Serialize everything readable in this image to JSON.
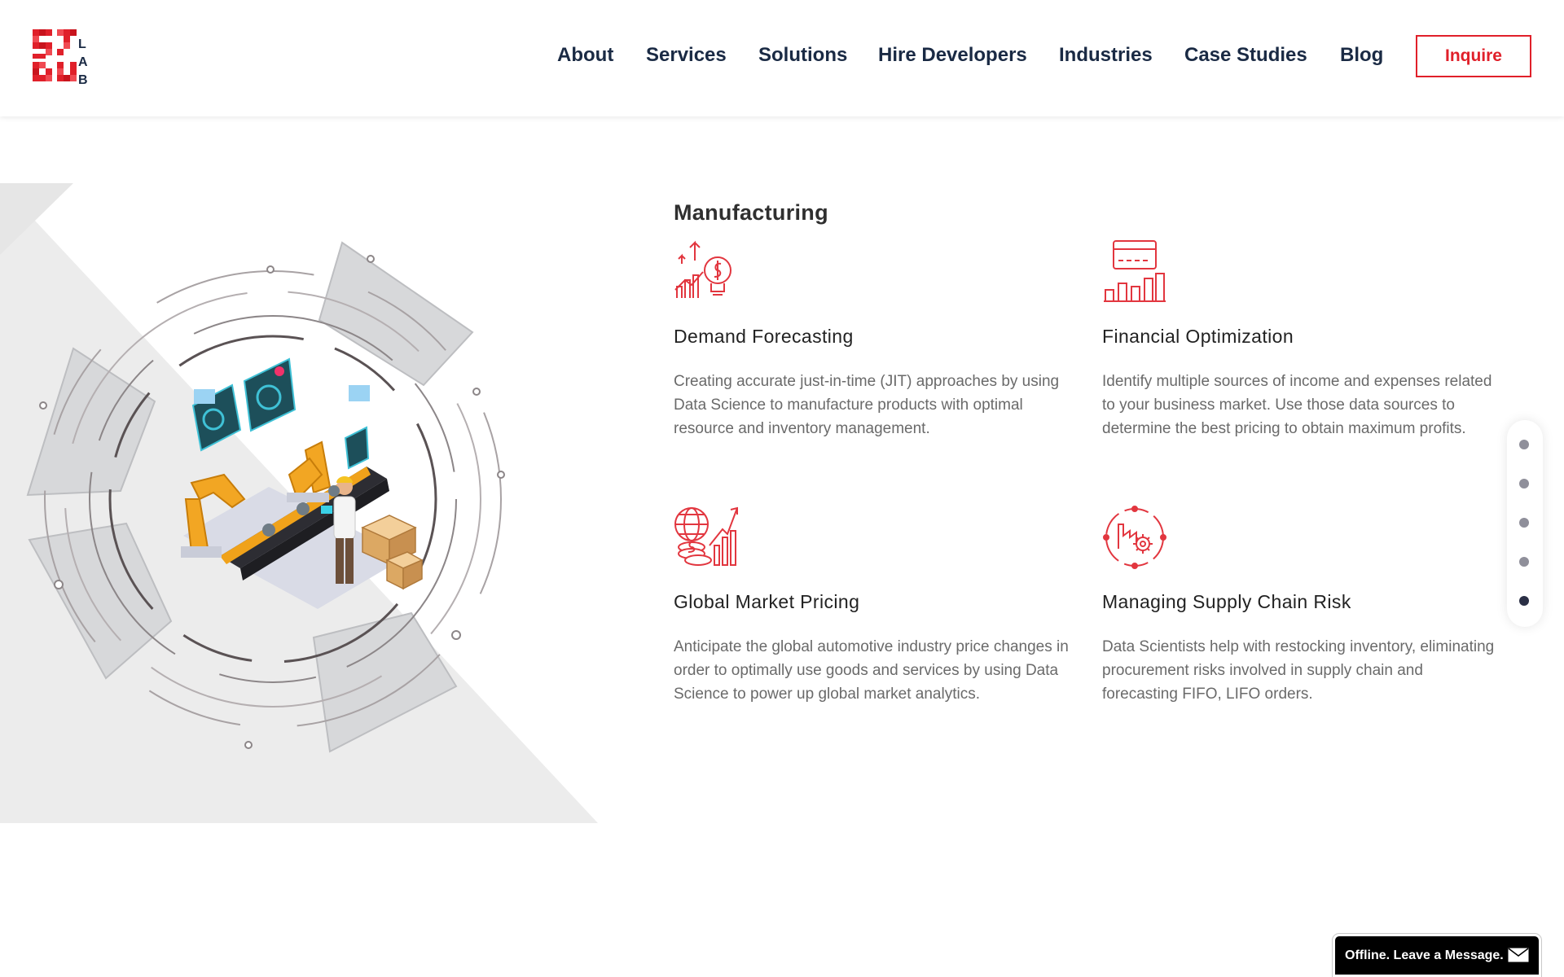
{
  "header": {
    "logo_letters": [
      "L",
      "A",
      "B"
    ],
    "nav": [
      {
        "label": "About"
      },
      {
        "label": "Services"
      },
      {
        "label": "Solutions"
      },
      {
        "label": "Hire Developers"
      },
      {
        "label": "Industries"
      },
      {
        "label": "Case Studies"
      },
      {
        "label": "Blog"
      }
    ],
    "cta_label": "Inquire"
  },
  "content": {
    "title": "Manufacturing",
    "features": [
      {
        "icon": "growth-lightbulb-icon",
        "title": "Demand Forecasting",
        "desc": "Creating accurate just-in-time (JIT) approaches by using Data Science to manufacture products with optimal resource and inventory management."
      },
      {
        "icon": "credit-card-chart-icon",
        "title": "Financial Optimization",
        "desc": "Identify multiple sources of income and expenses related to your business market. Use those data sources to determine the best pricing to obtain maximum profits."
      },
      {
        "icon": "globe-coins-chart-icon",
        "title": "Global Market Pricing",
        "desc": "Anticipate the global automotive industry price changes in order to optimally use goods and services by using Data Science to power up global market analytics."
      },
      {
        "icon": "factory-gear-cycle-icon",
        "title": "Managing Supply Chain Risk",
        "desc": "Data Scientists help with restocking inventory, eliminating procurement risks involved in supply chain and forecasting FIFO, LIFO orders."
      }
    ]
  },
  "side_nav": {
    "count": 5,
    "active_index": 4
  },
  "chat": {
    "label": "Offline. Leave a Message.",
    "icon": "envelope-icon"
  },
  "colors": {
    "accent": "#e0202a",
    "nav_text": "#1a2a44",
    "icon_red": "#e2363f"
  }
}
